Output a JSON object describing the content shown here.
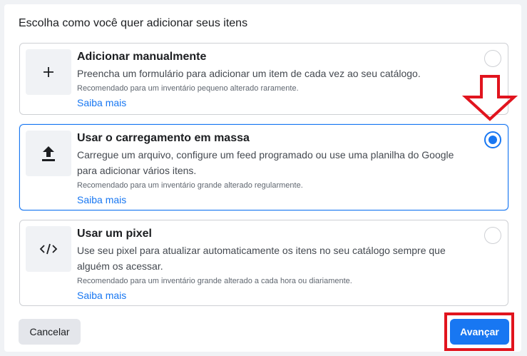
{
  "heading": "Escolha como você quer adicionar seus itens",
  "options": [
    {
      "title": "Adicionar manualmente",
      "description": "Preencha um formulário para adicionar um item de cada vez ao seu catálogo.",
      "recommendation": "Recomendado para um inventário pequeno alterado raramente.",
      "link": "Saiba mais",
      "icon": "plus-icon",
      "selected": false
    },
    {
      "title": "Usar o carregamento em massa",
      "description": "Carregue um arquivo, configure um feed programado ou use uma planilha do Google para adicionar vários itens.",
      "recommendation": "Recomendado para um inventário grande alterado regularmente.",
      "link": "Saiba mais",
      "icon": "upload-icon",
      "selected": true
    },
    {
      "title": "Usar um pixel",
      "description": "Use seu pixel para atualizar automaticamente os itens no seu catálogo sempre que alguém os acessar.",
      "recommendation": "Recomendado para um inventário grande alterado a cada hora ou diariamente.",
      "link": "Saiba mais",
      "icon": "code-icon",
      "selected": false
    }
  ],
  "footer": {
    "cancel_label": "Cancelar",
    "next_label": "Avançar"
  },
  "colors": {
    "accent": "#1877f2",
    "annotation": "#e1141e"
  }
}
